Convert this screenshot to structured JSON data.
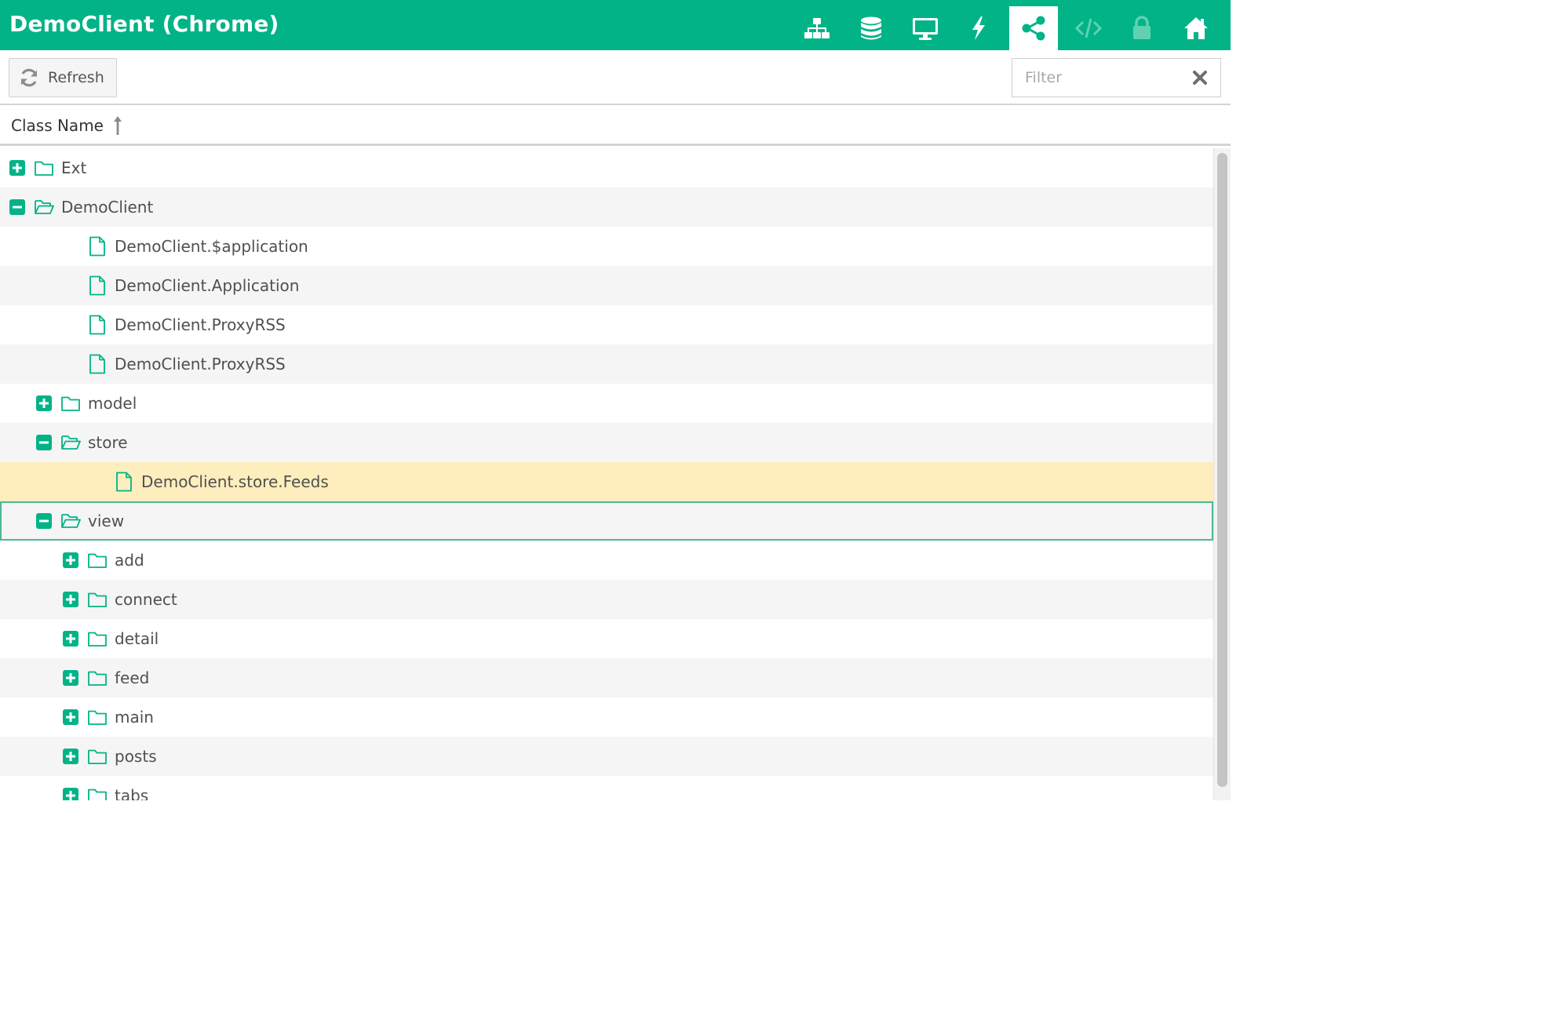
{
  "header": {
    "title": "DemoClient (Chrome)",
    "nav": [
      {
        "icon": "sitemap-icon",
        "active": false
      },
      {
        "icon": "database-icon",
        "active": false
      },
      {
        "icon": "monitor-icon",
        "active": false
      },
      {
        "icon": "bolt-icon",
        "active": false
      },
      {
        "icon": "share-icon",
        "active": true
      },
      {
        "icon": "code-icon",
        "active": false
      },
      {
        "icon": "lock-icon",
        "active": false
      },
      {
        "icon": "home-icon",
        "active": false
      }
    ]
  },
  "toolbar": {
    "refresh_label": "Refresh",
    "refresh_icon": "refresh-icon",
    "filter_placeholder": "Filter",
    "filter_value": "",
    "clear_icon": "clear-icon"
  },
  "columns": {
    "class_name": "Class Name",
    "sort": "ascending"
  },
  "tree": {
    "rows": [
      {
        "label": "Ext",
        "type": "folder",
        "expanded": false,
        "level": 0
      },
      {
        "label": "DemoClient",
        "type": "folder",
        "expanded": true,
        "level": 0
      },
      {
        "label": "DemoClient.$application",
        "type": "file",
        "level": 1
      },
      {
        "label": "DemoClient.Application",
        "type": "file",
        "level": 1
      },
      {
        "label": "DemoClient.ProxyRSS",
        "type": "file",
        "level": 1
      },
      {
        "label": "DemoClient.ProxyRSS",
        "type": "file",
        "level": 1
      },
      {
        "label": "model",
        "type": "folder",
        "expanded": false,
        "level": 1
      },
      {
        "label": "store",
        "type": "folder",
        "expanded": true,
        "level": 1
      },
      {
        "label": "DemoClient.store.Feeds",
        "type": "file",
        "level": 2,
        "selected": true
      },
      {
        "label": "view",
        "type": "folder",
        "expanded": true,
        "level": 1,
        "focused": true
      },
      {
        "label": "add",
        "type": "folder",
        "expanded": false,
        "level": 2
      },
      {
        "label": "connect",
        "type": "folder",
        "expanded": false,
        "level": 2
      },
      {
        "label": "detail",
        "type": "folder",
        "expanded": false,
        "level": 2
      },
      {
        "label": "feed",
        "type": "folder",
        "expanded": false,
        "level": 2
      },
      {
        "label": "main",
        "type": "folder",
        "expanded": false,
        "level": 2
      },
      {
        "label": "posts",
        "type": "folder",
        "expanded": false,
        "level": 2
      },
      {
        "label": "tabs",
        "type": "folder",
        "expanded": false,
        "level": 2
      }
    ]
  },
  "colors": {
    "accent": "#01b387",
    "selected_row": "#feeebd",
    "alt_row": "#f5f5f5"
  }
}
